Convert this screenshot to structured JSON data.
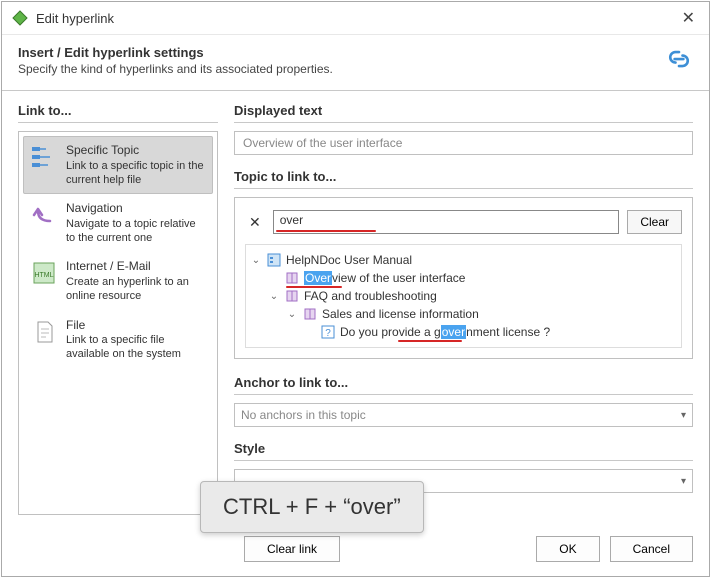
{
  "titlebar": {
    "title": "Edit hyperlink"
  },
  "header": {
    "title": "Insert / Edit hyperlink settings",
    "subtitle": "Specify the kind of hyperlinks and its associated properties."
  },
  "linkto": {
    "label": "Link to...",
    "items": [
      {
        "title": "Specific Topic",
        "desc": "Link to a specific topic in the current help file"
      },
      {
        "title": "Navigation",
        "desc": "Navigate to a topic relative to the current one"
      },
      {
        "title": "Internet / E-Mail",
        "desc": "Create an hyperlink to an online resource"
      },
      {
        "title": "File",
        "desc": "Link to a specific file available on the system"
      }
    ]
  },
  "displayed": {
    "label": "Displayed text",
    "value": "Overview of the user interface"
  },
  "topic": {
    "label": "Topic to link to...",
    "search_value": "over",
    "clear_label": "Clear",
    "tree": {
      "root": "HelpNDoc User Manual",
      "n1_pre": "",
      "n1_hl": "Over",
      "n1_post": "view of the user interface",
      "n2": "FAQ and troubleshooting",
      "n3": "Sales and license information",
      "n4_pre": "Do you provide a g",
      "n4_hl": "over",
      "n4_post": "nment license ?"
    }
  },
  "anchor": {
    "label": "Anchor to link to...",
    "value": "No anchors in this topic"
  },
  "style": {
    "label": "Style"
  },
  "footer": {
    "clear_link": "Clear link",
    "ok": "OK",
    "cancel": "Cancel"
  },
  "tooltip": "CTRL + F + “over”"
}
